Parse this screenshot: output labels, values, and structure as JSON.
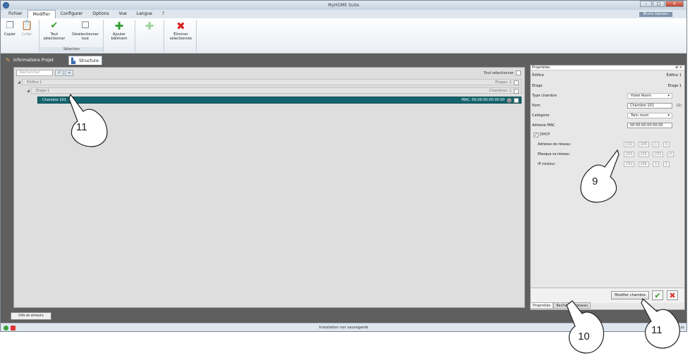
{
  "window": {
    "title": "MyHOME Suite",
    "user": "Bruno Galvani"
  },
  "menu": [
    "Fichier",
    "Modifier",
    "Configurer",
    "Options",
    "Vue",
    "Langue",
    "?"
  ],
  "ribbon": {
    "copy": "Copier",
    "paste": "Coller",
    "select_all": "Tout sélectionner",
    "deselect_all": "Désélectionner tout",
    "selection_group": "Sélection",
    "add_building": "Ajouter bâtiment",
    "delete_selected": "Éliminer sélectionnés"
  },
  "project_tabs": [
    "Informations Projet",
    "Structure"
  ],
  "main": {
    "search_placeholder": "Rechercher",
    "select_all_label": "Tout sélectionner",
    "tree": [
      {
        "label": "Édifice 1",
        "right": "Étages: 1"
      },
      {
        "label": "Etage 1",
        "right": "Chambres: 1"
      },
      {
        "label": "Chambre 101",
        "right": "MAC: 00:00:00:00:00:00"
      }
    ]
  },
  "properties": {
    "header": "Propriétés",
    "rows": [
      {
        "label": "Édifice",
        "value": "Édifice 1"
      },
      {
        "label": "Etage",
        "value": "Etage 1"
      },
      {
        "label": "Type chambre",
        "value": "Hotel Room"
      },
      {
        "label": "Nom",
        "value": "Chambre 101",
        "suffix": "(1)"
      },
      {
        "label": "Catégorie",
        "value": "Twin room"
      },
      {
        "label": "Adresse MAC",
        "value": "00:00:00:00:00:00"
      },
      {
        "label": "DHCP"
      },
      {
        "label": "Adresse de réseau",
        "ip": [
          "192",
          "168",
          "1",
          "5"
        ]
      },
      {
        "label": "Masque ss-réseau",
        "ip": [
          "255",
          "255",
          "255",
          "0"
        ]
      },
      {
        "label": "IP routeur",
        "ip": [
          "192",
          "168",
          "1",
          "1"
        ]
      }
    ],
    "modify_button": "Modifier chambre",
    "bottom_tabs": [
      "Propriétés",
      "Recherche réseau"
    ]
  },
  "info_button": "Info et erreurs",
  "status": "Installation non sauvegardé",
  "status_right": "ss",
  "callouts": [
    "11",
    "9",
    "10",
    "11"
  ]
}
